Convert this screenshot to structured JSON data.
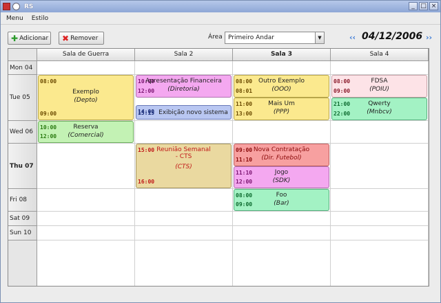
{
  "window": {
    "title": "RS",
    "min": "_",
    "max": "□",
    "close": "×"
  },
  "menu": [
    {
      "label": "Menu"
    },
    {
      "label": "Estilo"
    }
  ],
  "toolbar": {
    "add_label": "Adicionar",
    "remove_label": "Remover",
    "area_label": "Área",
    "area_value": "Primeiro Andar",
    "date": "04/12/2006",
    "prev_icon": "‹‹",
    "next_icon": "››"
  },
  "rooms": [
    {
      "label": "Sala de Guerra"
    },
    {
      "label": "Sala 2"
    },
    {
      "label": "Sala 3",
      "current": true
    },
    {
      "label": "Sala 4"
    }
  ],
  "days": [
    {
      "label": "Mon 04"
    },
    {
      "label": "Tue 05"
    },
    {
      "label": "Wed 06"
    },
    {
      "label": "Thu 07",
      "current": true
    },
    {
      "label": "Fri 08"
    },
    {
      "label": "Sat 09"
    },
    {
      "label": "Sun 10"
    }
  ],
  "events": [
    {
      "room": 0,
      "day": 1,
      "start": "08:00",
      "end": "09:00",
      "title": "Exemplo",
      "owner": "(Depto)",
      "color": "yellow"
    },
    {
      "room": 0,
      "day": 2,
      "start": "10:00",
      "end": "12:00",
      "title": "Reserva",
      "owner": "(Comercial)",
      "color": "lgreen"
    },
    {
      "room": 1,
      "day": 1,
      "start": "10:00",
      "end": "12:00",
      "title": "Apresentação Financeira",
      "owner": "(Diretoria)",
      "color": "pink"
    },
    {
      "room": 1,
      "day": 1,
      "start": "14:00",
      "end": "15:15",
      "title": "Exibição novo sistema",
      "owner": "",
      "color": "blue"
    },
    {
      "room": 1,
      "day": 3,
      "start": "15:00",
      "end": "16:00",
      "title": "Reunião Semanal - CTS",
      "owner": "(CTS)",
      "color": "tan"
    },
    {
      "room": 2,
      "day": 1,
      "start": "08:00",
      "end": "08:01",
      "title": "Outro Exemplo",
      "owner": "(OOO)",
      "color": "yellow"
    },
    {
      "room": 2,
      "day": 1,
      "start": "11:00",
      "end": "13:00",
      "title": "Mais Um",
      "owner": "(PPP)",
      "color": "yellow"
    },
    {
      "room": 2,
      "day": 3,
      "start": "09:00",
      "end": "11:10",
      "title": "Nova Contratação",
      "owner": "(Dir. Futebol)",
      "color": "red"
    },
    {
      "room": 2,
      "day": 3,
      "start": "11:10",
      "end": "12:00",
      "title": "Jogo",
      "owner": "(SDK)",
      "color": "pink"
    },
    {
      "room": 2,
      "day": 4,
      "start": "08:00",
      "end": "09:00",
      "title": "Foo",
      "owner": "(Bar)",
      "color": "green"
    },
    {
      "room": 3,
      "day": 1,
      "start": "08:00",
      "end": "09:00",
      "title": "FDSA",
      "owner": "(POIU)",
      "color": "lpink"
    },
    {
      "room": 3,
      "day": 1,
      "start": "21:00",
      "end": "22:00",
      "title": "Qwerty",
      "owner": "(Mnbcv)",
      "color": "green"
    }
  ]
}
